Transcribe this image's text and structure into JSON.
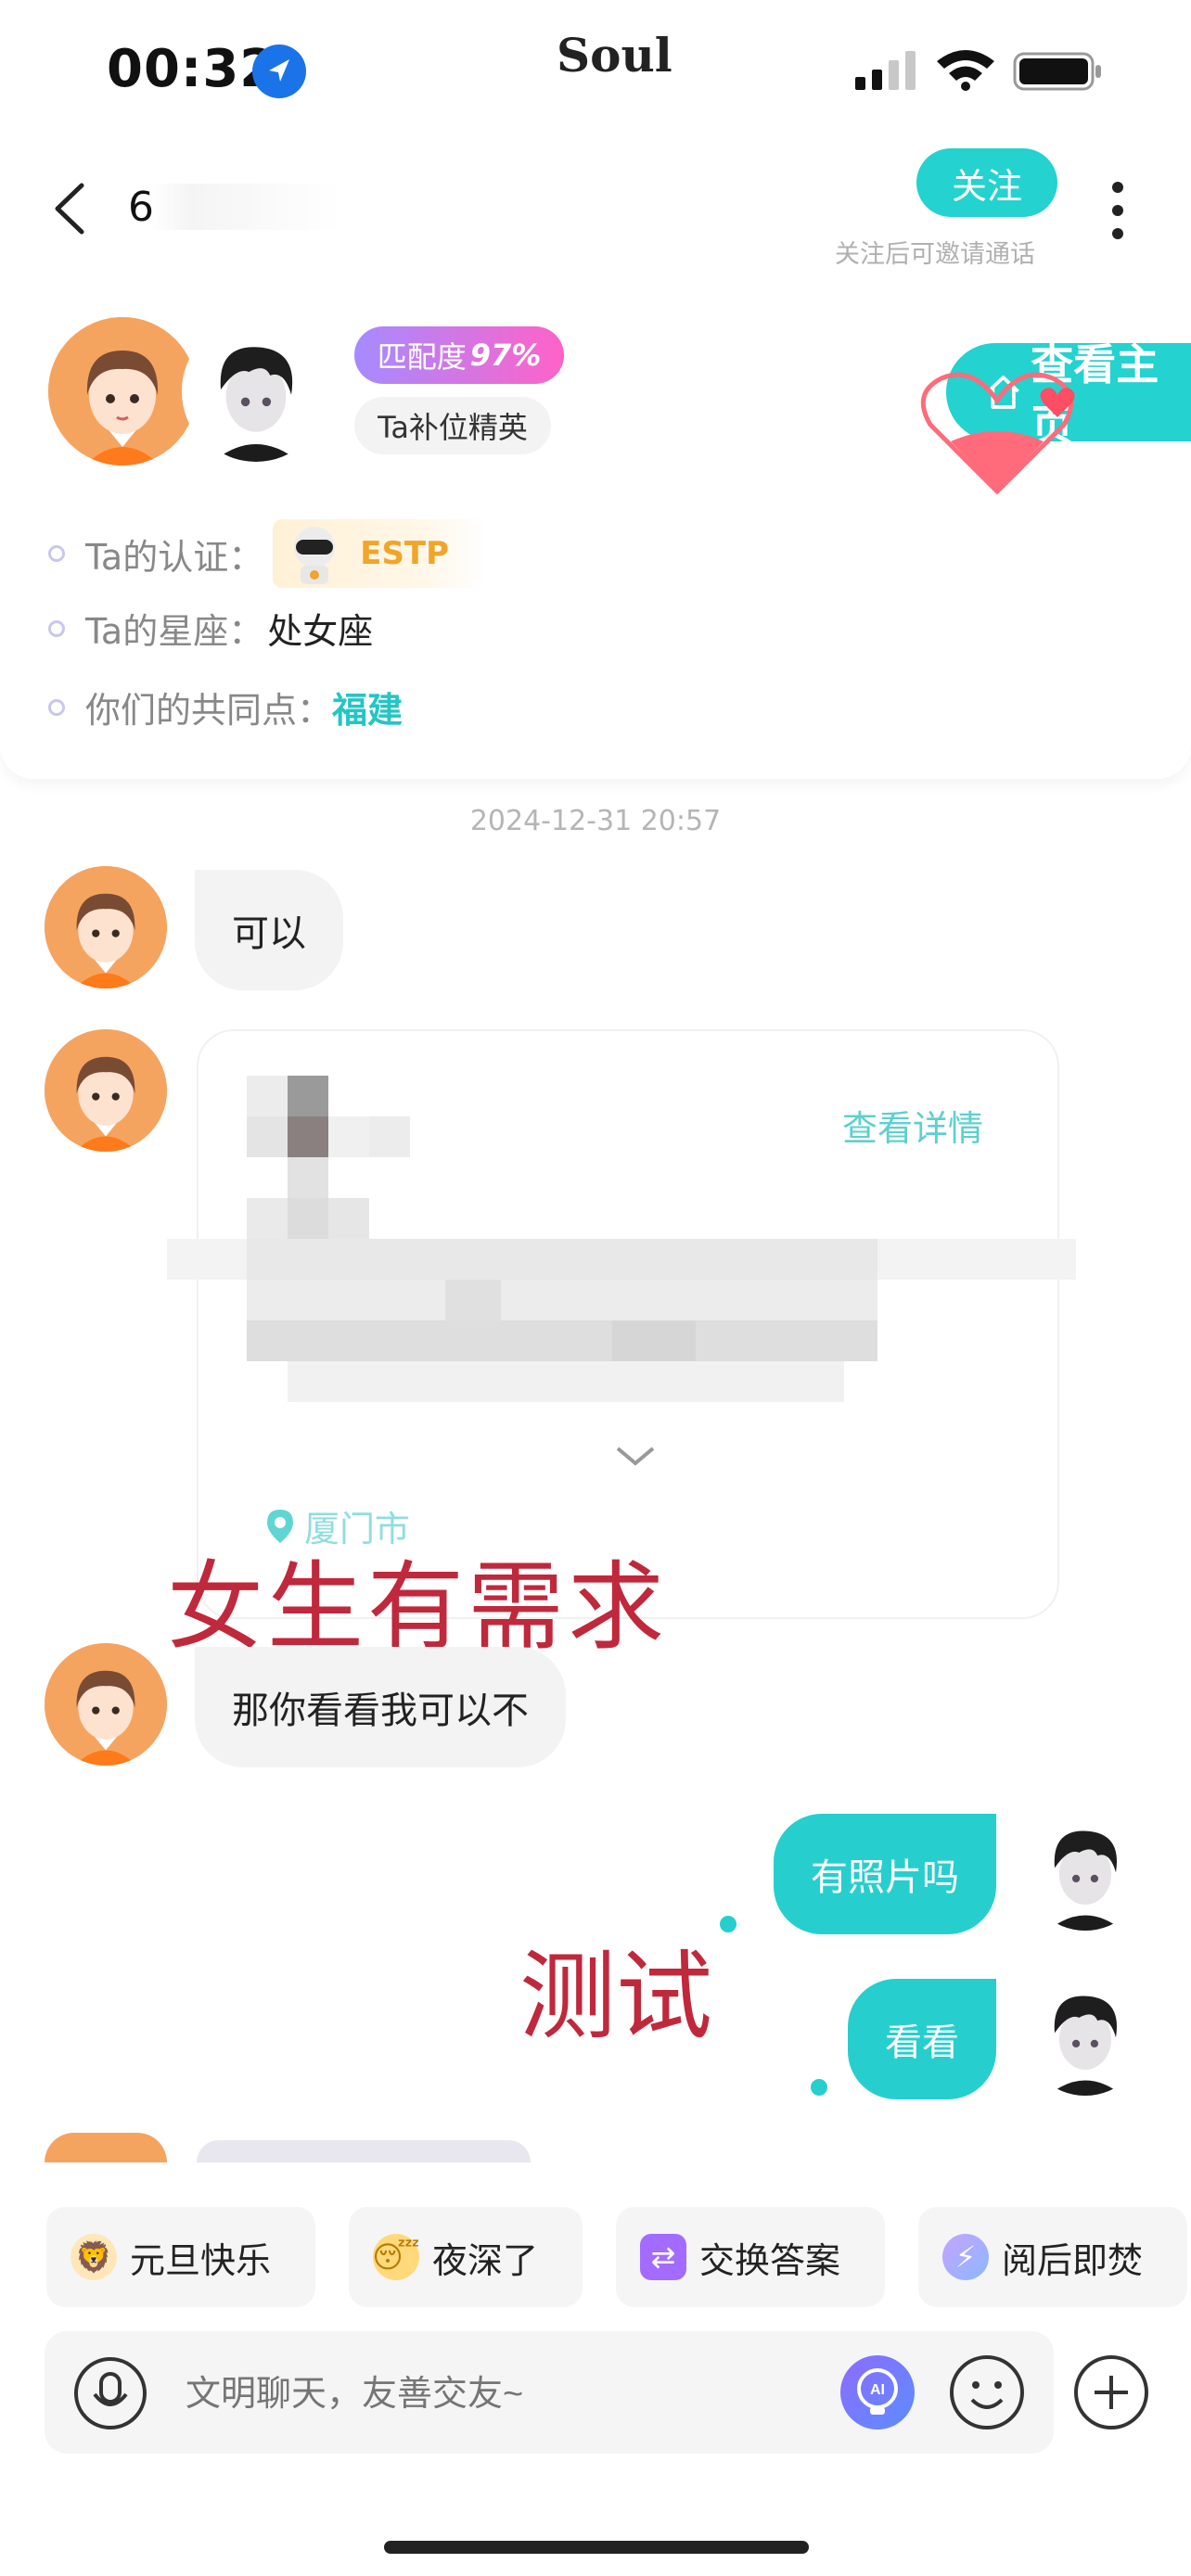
{
  "status_bar": {
    "time": "00:32",
    "carrier": "Soul"
  },
  "header": {
    "contact_name": "6",
    "follow_label": "关注",
    "follow_hint": "关注后可邀请通话"
  },
  "profile": {
    "match_label": "匹配度",
    "match_value": "97%",
    "tag": "Ta补位精英",
    "homepage_label": "查看主页",
    "cert_label": "Ta的认证：",
    "cert_value": "ESTP",
    "zodiac_label": "Ta的星座：",
    "zodiac_value": "处女座",
    "common_label": "你们的共同点：",
    "common_value": "福建"
  },
  "chat": {
    "timestamp": "2024-12-31 20:57",
    "messages": [
      {
        "from": "other",
        "text": "可以"
      },
      {
        "from": "other",
        "type": "card",
        "link": "查看详情",
        "location": "厦门市"
      },
      {
        "from": "other",
        "text": "那你看看我可以不"
      },
      {
        "from": "me",
        "text": "有照片吗"
      },
      {
        "from": "me",
        "text": "看看"
      }
    ],
    "overlay_1": "女生有需求",
    "overlay_2": "测试"
  },
  "quick_replies": [
    {
      "label": "元旦快乐",
      "icon": "lion-dance-icon"
    },
    {
      "label": "夜深了",
      "icon": "sleepy-face-icon"
    },
    {
      "label": "交换答案",
      "icon": "exchange-icon"
    },
    {
      "label": "阅后即焚",
      "icon": "flash-icon"
    }
  ],
  "input": {
    "placeholder": "文明聊天，友善交友~"
  },
  "colors": {
    "accent": "#26cfcd",
    "overlay_red": "#c0283c",
    "avatar_bg": "#f5a460"
  }
}
